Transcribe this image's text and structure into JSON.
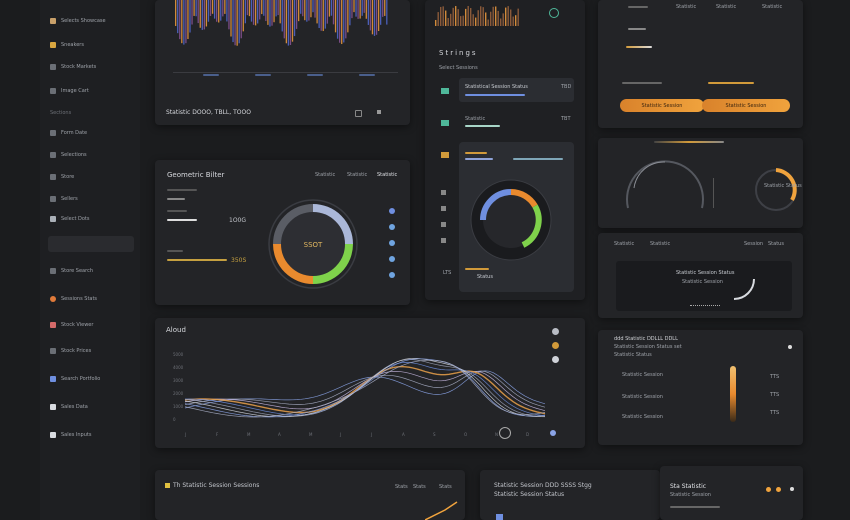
{
  "sidebar": {
    "items": [
      {
        "label": "Selects Showcase"
      },
      {
        "label": "Sneakers"
      },
      {
        "label": "Stock Markets"
      },
      {
        "label": "Image Cart"
      }
    ],
    "section_label": "Sections",
    "sub_items": [
      {
        "label": "Form Date"
      },
      {
        "label": "Selections"
      },
      {
        "label": "Store"
      },
      {
        "label": "Sellers"
      },
      {
        "label": "Select Dots"
      }
    ],
    "lower_items": [
      {
        "label": "Store Search"
      },
      {
        "label": "Sessions Stats"
      },
      {
        "label": "Stock Viewer"
      },
      {
        "label": "Stock Prices"
      },
      {
        "label": "Search Portfolio"
      },
      {
        "label": "Sales Data"
      },
      {
        "label": "Sales Inputs"
      }
    ]
  },
  "top_panel": {
    "footer_title": "Statistic DOOO, TBLL, TOOO"
  },
  "donut_panel": {
    "title": "Geometric Bilter",
    "legend": [
      "Statistic",
      "Statistic",
      "Statistic"
    ],
    "left_value": "1O0G",
    "bottom_value": "350S",
    "center_value": "SSOT"
  },
  "strings_panel": {
    "heading": "Strings",
    "sub": "Select Sessions",
    "rows": [
      {
        "label": "Statistical Session Status",
        "value": "TBD"
      },
      {
        "label": "Statistic",
        "value": "TBT"
      },
      {
        "label": "Statistic",
        "value": ""
      }
    ],
    "footer_a": "LTS",
    "footer_b": "Status"
  },
  "right_top": {
    "labels": [
      "Statistic",
      "Statistic",
      "Statistic"
    ],
    "button_a": "Statistic Session",
    "button_b": "Statistic Session"
  },
  "right_mid": {
    "header": "Statistic",
    "tabs": [
      "Statistic",
      "Session",
      "Status"
    ],
    "line1": "Statistic Session Status",
    "line2": "Statistic Session",
    "line3": "Statistic Status"
  },
  "right_lower": {
    "title": "ddd Statistic DDLLL DDLL",
    "line1": "Statistic Session Status set",
    "line2": "Statistic Status",
    "rows": [
      "Statistic Session",
      "Statistic Session",
      "Statistic Session"
    ],
    "vals": [
      "TTS",
      "TTS",
      "TTS"
    ]
  },
  "wave_panel": {
    "title": "Aloud",
    "y_ticks": [
      "5000",
      "4000",
      "3000",
      "2000",
      "1000",
      "0"
    ],
    "x_ticks": [
      "J",
      "F",
      "M",
      "A",
      "M",
      "J",
      "J",
      "A",
      "S",
      "O",
      "N",
      "D"
    ]
  },
  "bottom_panel_a": {
    "title": "Th Statistic Session Sessions",
    "tabs": [
      "Stats",
      "Stats",
      "Stats"
    ]
  },
  "bottom_panel_b": {
    "line1": "Statistic Session DDD SSSS Stgg",
    "line2": "Statistic Session Status"
  },
  "bottom_panel_c": {
    "title": "Sta Statistic",
    "sub": "Statistic Session"
  },
  "colors": {
    "accent": "#f0a33d",
    "blue": "#6f8fe0",
    "green": "#7fd24b",
    "orange": "#e98a2e"
  }
}
